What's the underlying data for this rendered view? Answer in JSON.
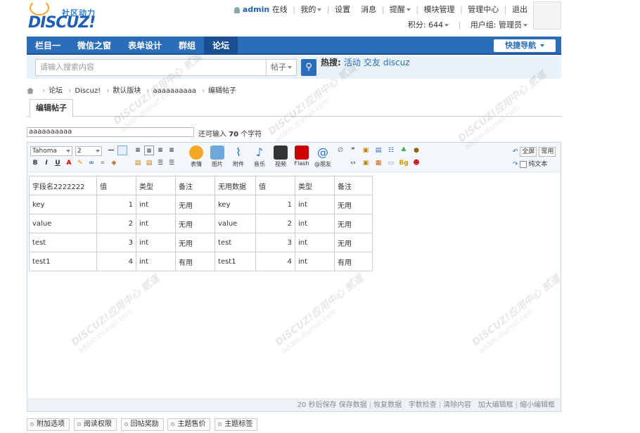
{
  "header": {
    "slogan": "社区动力",
    "brand": "DISCUZ!",
    "username": "admin",
    "online": "在线",
    "menu": [
      "我的",
      "设置",
      "消息",
      "提醒",
      "模块管理",
      "管理中心",
      "退出"
    ],
    "points": "积分: 644",
    "usergroup": "用户组: 管理员"
  },
  "nav": {
    "items": [
      "栏目一",
      "微信之窗",
      "表单设计",
      "群组",
      "论坛"
    ],
    "quick": "快捷导航"
  },
  "search": {
    "placeholder": "请输入搜索内容",
    "type": "帖子",
    "hot_label": "热搜:",
    "hot_items": [
      "活动",
      "交友",
      "discuz"
    ]
  },
  "breadcrumb": [
    "论坛",
    "Discuz!",
    "默认版块",
    "aaaaaaaaaa",
    "编辑帖子"
  ],
  "tab": "编辑帖子",
  "subject": {
    "value": "aaaaaaaaaa",
    "hint_prefix": "还可输入",
    "hint_count": "70",
    "hint_suffix": "个字符"
  },
  "toolbar": {
    "font": "Tahoma",
    "size": "2",
    "buttons": [
      "表情",
      "图片",
      "附件",
      "音乐",
      "视频",
      "Flash",
      "@朋友"
    ],
    "fullscreen": "全屏",
    "common": "常用",
    "plaintext": "纯文本"
  },
  "table": {
    "rows": [
      [
        "字段名2222222",
        "值",
        "类型",
        "备注",
        "无用数据",
        "值",
        "类型",
        "备注"
      ],
      [
        "key",
        "1",
        "int",
        "无用",
        "key",
        "1",
        "int",
        "无用"
      ],
      [
        "value",
        "2",
        "int",
        "无用",
        "value",
        "2",
        "int",
        "无用"
      ],
      [
        "test",
        "3",
        "int",
        "无用",
        "test",
        "3",
        "int",
        "无用"
      ],
      [
        "test1",
        "4",
        "int",
        "有用",
        "test1",
        "4",
        "int",
        "有用"
      ]
    ]
  },
  "statusbar": {
    "autosave": "20 秒后保存",
    "items": [
      "保存数据",
      "恢复数据",
      "字数检查",
      "清除内容",
      "加大编辑框",
      "缩小编辑框"
    ]
  },
  "bottom_tabs": [
    "附加选项",
    "阅读权限",
    "回帖奖励",
    "主题售价",
    "主题标签"
  ],
  "watermark": {
    "brand": "DISCUZ!应用中心",
    "site": "addon.dismall.com",
    "mark": "贰道"
  }
}
